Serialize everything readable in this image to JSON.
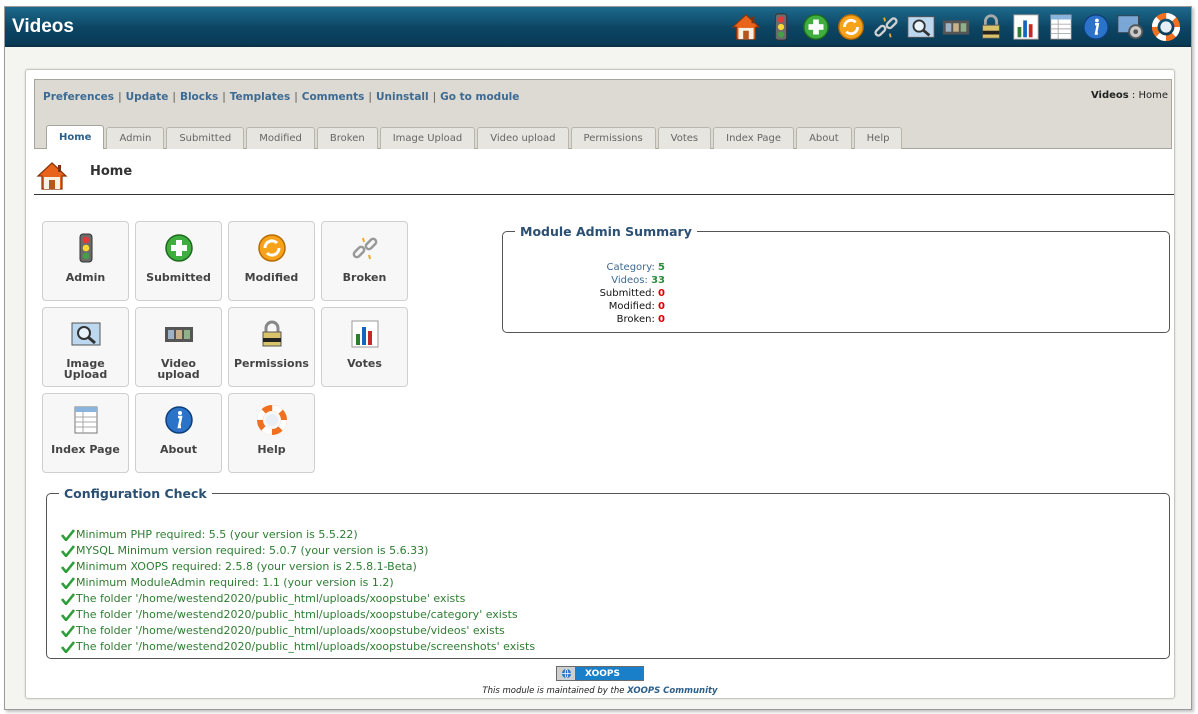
{
  "header": {
    "title": "Videos"
  },
  "top_icons": [
    "home-icon",
    "traffic-light-icon",
    "add-icon",
    "refresh-icon",
    "broken-link-icon",
    "image-search-icon",
    "film-icon",
    "lock-icon",
    "bar-chart-icon",
    "spreadsheet-icon",
    "info-icon",
    "settings-icon",
    "help-lifebuoy-icon"
  ],
  "nav": {
    "links": [
      "Preferences",
      "Update",
      "Blocks",
      "Templates",
      "Comments",
      "Uninstall",
      "Go to module"
    ],
    "separator": "|",
    "breadcrumb_module": "Videos",
    "breadcrumb_sep": ":",
    "breadcrumb_page": "Home"
  },
  "tabs": [
    "Home",
    "Admin",
    "Submitted",
    "Modified",
    "Broken",
    "Image Upload",
    "Video upload",
    "Permissions",
    "Votes",
    "Index Page",
    "About",
    "Help"
  ],
  "active_tab": "Home",
  "page": {
    "title": "Home"
  },
  "buttons": [
    {
      "label": "Admin",
      "icon": "traffic-light-icon"
    },
    {
      "label": "Submitted",
      "icon": "add-icon"
    },
    {
      "label": "Modified",
      "icon": "refresh-icon"
    },
    {
      "label": "Broken",
      "icon": "broken-link-icon"
    },
    {
      "label": "Image Upload",
      "icon": "image-search-icon"
    },
    {
      "label": "Video upload",
      "icon": "film-icon"
    },
    {
      "label": "Permissions",
      "icon": "lock-icon"
    },
    {
      "label": "Votes",
      "icon": "bar-chart-icon"
    },
    {
      "label": "Index Page",
      "icon": "spreadsheet-icon"
    },
    {
      "label": "About",
      "icon": "info-icon"
    },
    {
      "label": "Help",
      "icon": "help-lifebuoy-icon"
    }
  ],
  "summary": {
    "title": "Module Admin Summary",
    "rows": [
      {
        "label": "Category:",
        "value": "5"
      },
      {
        "label": "Videos:",
        "value": "33"
      },
      {
        "label": "Submitted:",
        "value": "0"
      },
      {
        "label": "Modified:",
        "value": "0"
      },
      {
        "label": "Broken:",
        "value": "0"
      }
    ]
  },
  "config": {
    "title": "Configuration Check",
    "checks": [
      "Minimum PHP required: 5.5 (your version is 5.5.22)",
      "MYSQL Minimum version required: 5.0.7 (your version is 5.6.33)",
      "Minimum XOOPS required: 2.5.8 (your version is 2.5.8.1-Beta)",
      "Minimum ModuleAdmin required: 1.1 (your version is 1.2)",
      "The folder '/home/westend2020/public_html/uploads/xoopstube' exists",
      "The folder '/home/westend2020/public_html/uploads/xoopstube/category' exists",
      "The folder '/home/westend2020/public_html/uploads/xoopstube/videos' exists",
      "The folder '/home/westend2020/public_html/uploads/xoopstube/screenshots' exists"
    ]
  },
  "footer": {
    "badge": "XOOPS",
    "text": "This module is maintained by the",
    "link": "XOOPS Community"
  },
  "colors": {
    "header_bg": "#0c4563",
    "link": "#3c6a93",
    "ok_green": "#2e7d32",
    "zero_red": "#e00000"
  }
}
